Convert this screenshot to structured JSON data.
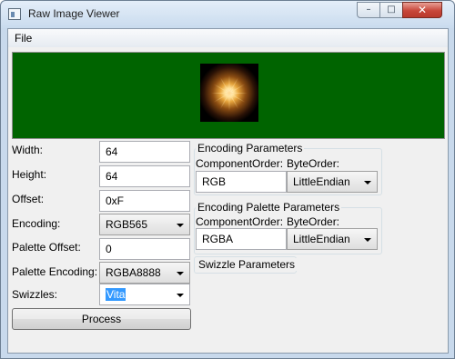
{
  "window": {
    "title": "Raw Image Viewer",
    "minimize_glyph": "–",
    "maximize_glyph": "□",
    "close_glyph": "✕"
  },
  "menu": {
    "file": "File"
  },
  "preview": {
    "background_color": "#006400"
  },
  "fields": {
    "width_label": "Width:",
    "width_value": "64",
    "height_label": "Height:",
    "height_value": "64",
    "offset_label": "Offset:",
    "offset_value": "0xF",
    "encoding_label": "Encoding:",
    "encoding_value": "RGB565",
    "palette_offset_label": "Palette Offset:",
    "palette_offset_value": "0",
    "palette_encoding_label": "Palette Encoding:",
    "palette_encoding_value": "RGBA8888",
    "swizzles_label": "Swizzles:",
    "swizzles_value": "Vita"
  },
  "process_button": "Process",
  "encoding_params": {
    "title": "Encoding Parameters",
    "component_order_label": "ComponentOrder:",
    "byte_order_label": "ByteOrder:",
    "component_order_value": "RGB",
    "byte_order_value": "LittleEndian"
  },
  "palette_params": {
    "title": "Encoding Palette Parameters",
    "component_order_label": "ComponentOrder:",
    "byte_order_label": "ByteOrder:",
    "component_order_value": "RGBA",
    "byte_order_value": "LittleEndian"
  },
  "swizzle_params": {
    "title": "Swizzle Parameters"
  }
}
